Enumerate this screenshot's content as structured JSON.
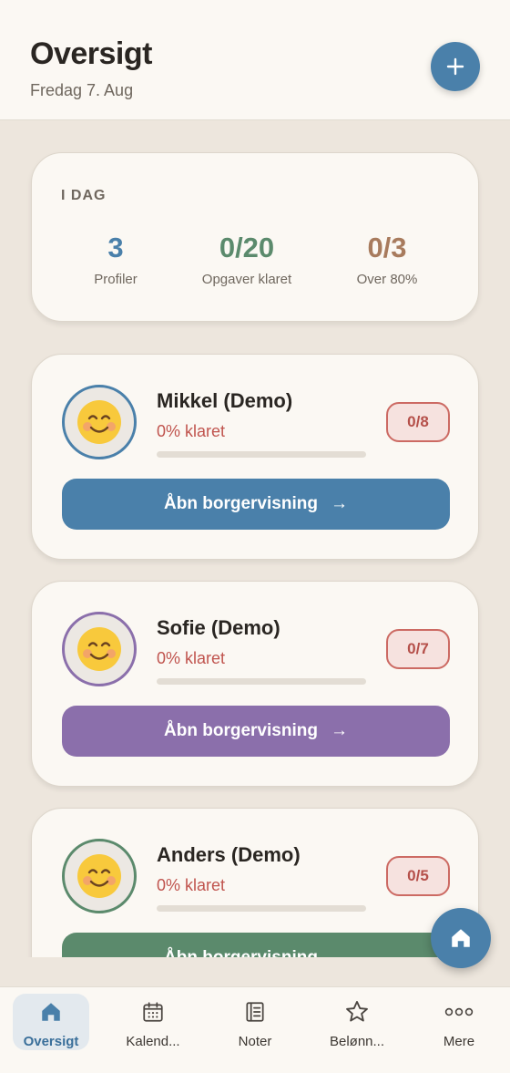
{
  "header": {
    "title": "Oversigt",
    "subtitle": "Fredag 7. Aug",
    "add_icon": "plus-icon"
  },
  "today": {
    "heading": "I DAG",
    "stats": [
      {
        "value": "3",
        "label": "Profiler",
        "color": "#4a80aa"
      },
      {
        "value": "0/20",
        "label": "Opgaver klaret",
        "color": "#5b8a6c"
      },
      {
        "value": "0/3",
        "label": "Over 80%",
        "color": "#a87b5d"
      }
    ]
  },
  "profiles": [
    {
      "name": "Mikkel (Demo)",
      "progress_text": "0% klaret",
      "progress": 0,
      "badge": "0/8",
      "button_label": "Åbn borgervisning",
      "arrow": "→",
      "color": "#4a80aa",
      "avatar_icon": "smiling-face-icon"
    },
    {
      "name": "Sofie (Demo)",
      "progress_text": "0% klaret",
      "progress": 0,
      "badge": "0/7",
      "button_label": "Åbn borgervisning",
      "arrow": "→",
      "color": "#8b6fab",
      "avatar_icon": "smiling-face-icon"
    },
    {
      "name": "Anders (Demo)",
      "progress_text": "0% klaret",
      "progress": 0,
      "badge": "0/5",
      "button_label": "Åbn borgervisning",
      "arrow": "→",
      "color": "#5b8a6c",
      "avatar_icon": "smiling-face-icon"
    }
  ],
  "fab": {
    "icon": "home-icon"
  },
  "nav": {
    "items": [
      {
        "label": "Oversigt",
        "icon": "home-icon",
        "active": true
      },
      {
        "label": "Kalend...",
        "icon": "calendar-icon",
        "active": false
      },
      {
        "label": "Noter",
        "icon": "notes-icon",
        "active": false
      },
      {
        "label": "Belønn...",
        "icon": "star-icon",
        "active": false
      },
      {
        "label": "Mere",
        "icon": "more-icon",
        "active": false
      }
    ]
  }
}
